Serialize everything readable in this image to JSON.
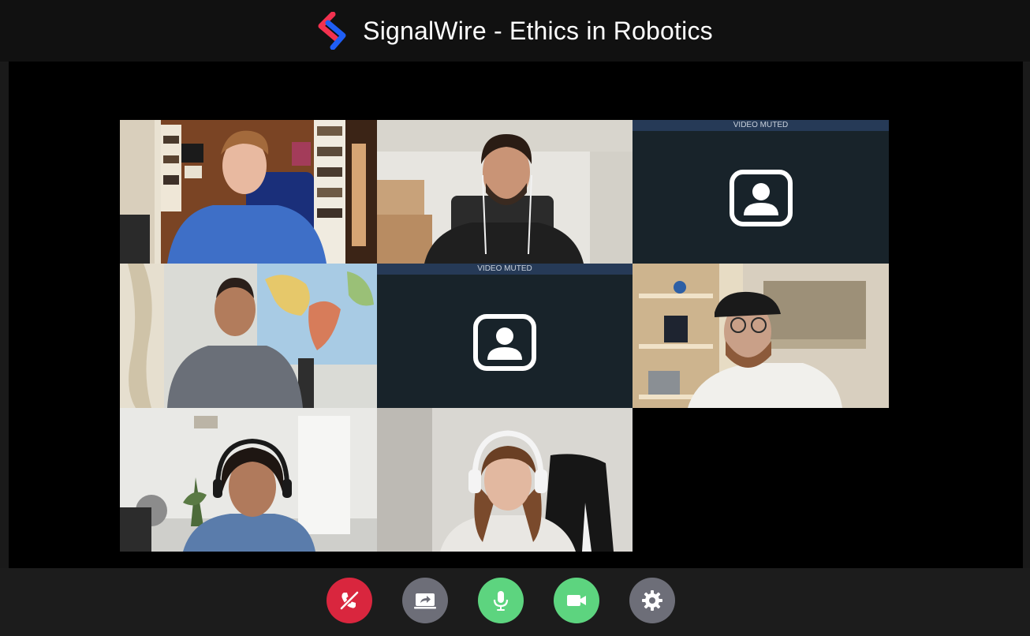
{
  "app": {
    "title": "SignalWire - Ethics in Robotics"
  },
  "participants": [
    {
      "id": "p1",
      "video_muted": false
    },
    {
      "id": "p2",
      "video_muted": false
    },
    {
      "id": "p3",
      "video_muted": true,
      "muted_label": "VIDEO MUTED"
    },
    {
      "id": "p4",
      "video_muted": false
    },
    {
      "id": "p5",
      "video_muted": true,
      "muted_label": "VIDEO MUTED"
    },
    {
      "id": "p6",
      "video_muted": false
    },
    {
      "id": "p7",
      "video_muted": false
    },
    {
      "id": "p8",
      "video_muted": false
    }
  ],
  "controls": [
    {
      "name": "hangup-button",
      "icon": "hangup-icon",
      "color": "#d9263e"
    },
    {
      "name": "screen-share-button",
      "icon": "screen-share-icon",
      "color": "#6d6e78"
    },
    {
      "name": "microphone-button",
      "icon": "microphone-icon",
      "color": "#5dd47f"
    },
    {
      "name": "camera-button",
      "icon": "camera-icon",
      "color": "#5dd47f"
    },
    {
      "name": "settings-button",
      "icon": "gear-icon",
      "color": "#6d6e78"
    }
  ],
  "colors": {
    "brand_blue": "#1f5ef5",
    "brand_red": "#f2314f"
  }
}
